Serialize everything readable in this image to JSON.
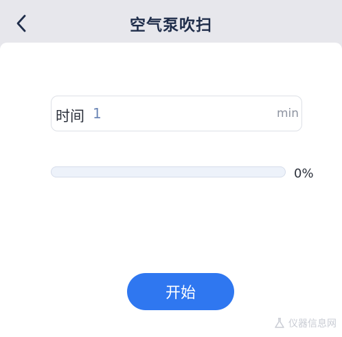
{
  "header": {
    "title": "空气泵吹扫",
    "back_icon": "chevron-left-icon"
  },
  "time_field": {
    "label": "时间",
    "value": "1",
    "unit": "min"
  },
  "progress": {
    "percent": 0,
    "text": "0%"
  },
  "actions": {
    "start_label": "开始"
  },
  "watermark": {
    "text": "仪器信息网",
    "icon": "flask-icon"
  },
  "colors": {
    "accent": "#2f77f0",
    "header_bg": "#e7e7ec",
    "title": "#1f2d4a",
    "value": "#6c86b6"
  }
}
